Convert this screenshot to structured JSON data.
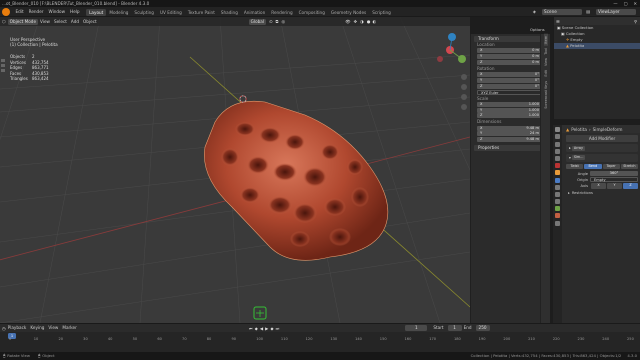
{
  "window": {
    "title": "...ot_Blender_010 [F:\\BLENDER\\Tut_Blender_010.blend] - Blender 4.3.0",
    "controls": [
      "—",
      "▢",
      "✕"
    ]
  },
  "menubar": {
    "items": [
      "Edit",
      "Render",
      "Window",
      "Help"
    ],
    "workspaces": [
      "Layout",
      "Modeling",
      "Sculpting",
      "UV Editing",
      "Texture Paint",
      "Shading",
      "Animation",
      "Rendering",
      "Compositing",
      "Geometry Nodes",
      "Scripting"
    ],
    "active_workspace": "Layout",
    "scene": "Scene",
    "view_layer": "ViewLayer"
  },
  "viewport": {
    "mode": "Object Mode",
    "menus": [
      "View",
      "Select",
      "Add",
      "Object"
    ],
    "transform_orientation": "Global",
    "options_label": "Options",
    "overlay_title": "User Perspective",
    "overlay_collection": "(1) Collection | Pelotita",
    "stats": [
      {
        "label": "Objects",
        "value": "2"
      },
      {
        "label": "Vertices",
        "value": "432,754"
      },
      {
        "label": "Edges",
        "value": "863,771"
      },
      {
        "label": "Faces",
        "value": "430,853"
      },
      {
        "label": "Triangles",
        "value": "863,424"
      }
    ],
    "object_color": "#b8553a"
  },
  "n_panel": {
    "section_title": "Transform",
    "location_label": "Location",
    "location": [
      {
        "axis": "X",
        "value": "0 m"
      },
      {
        "axis": "Y",
        "value": "0 m"
      },
      {
        "axis": "Z",
        "value": "0 m"
      }
    ],
    "rotation_label": "Rotation",
    "rotation": [
      {
        "axis": "X",
        "value": "0°"
      },
      {
        "axis": "Y",
        "value": "0°"
      },
      {
        "axis": "Z",
        "value": "0°"
      }
    ],
    "rotation_mode": "XYZ Euler",
    "scale_label": "Scale",
    "scale": [
      {
        "axis": "X",
        "value": "1.000"
      },
      {
        "axis": "Y",
        "value": "1.000"
      },
      {
        "axis": "Z",
        "value": "1.000"
      }
    ],
    "dimensions_label": "Dimensions",
    "dimensions": [
      {
        "axis": "X",
        "value": "9.48 m"
      },
      {
        "axis": "Y",
        "value": "24 m"
      },
      {
        "axis": "Z",
        "value": "9.48 m"
      }
    ],
    "properties_title": "Properties",
    "tabs": [
      "Item",
      "Tool",
      "View",
      "Edit",
      "Screencast Keys"
    ]
  },
  "outliner": {
    "root": "Scene Collection",
    "items": [
      {
        "name": "Collection",
        "level": 1
      },
      {
        "name": "Empty",
        "level": 2
      },
      {
        "name": "Pelotita",
        "level": 2
      }
    ]
  },
  "properties": {
    "object_name": "Pelotita",
    "modifier_stack": "SimpleDeform",
    "add_modifier_label": "Add Modifier",
    "modifiers": [
      "Array",
      "Sim..."
    ],
    "deform_tabs": [
      "Twist",
      "Bend",
      "Taper",
      "Stretch"
    ],
    "active_deform_tab": "Bend",
    "angle_label": "Angle",
    "angle_value": "360°",
    "origin_label": "Origin",
    "origin_value": "Empty",
    "axis_label": "Axis",
    "axes": [
      "X",
      "Y",
      "Z"
    ],
    "restrictions_label": "Restrictions"
  },
  "timeline": {
    "menus": [
      "Playback",
      "Keying",
      "View",
      "Marker"
    ],
    "current_frame": "1",
    "start_label": "Start",
    "start_value": "1",
    "end_label": "End",
    "end_value": "250",
    "ticks": [
      "0",
      "10",
      "20",
      "30",
      "40",
      "50",
      "60",
      "70",
      "80",
      "90",
      "100",
      "110",
      "120",
      "130",
      "140",
      "150",
      "160",
      "170",
      "180",
      "190",
      "200",
      "210",
      "220",
      "230",
      "240",
      "250"
    ]
  },
  "status": {
    "left_action": "Rotate View",
    "left_action2": "Object",
    "right_info": "Collection | Pelotita | Verts:432,754 | Faces:430,853 | Tris:863,424 | Objects:1/2",
    "version": "4.3.0"
  }
}
